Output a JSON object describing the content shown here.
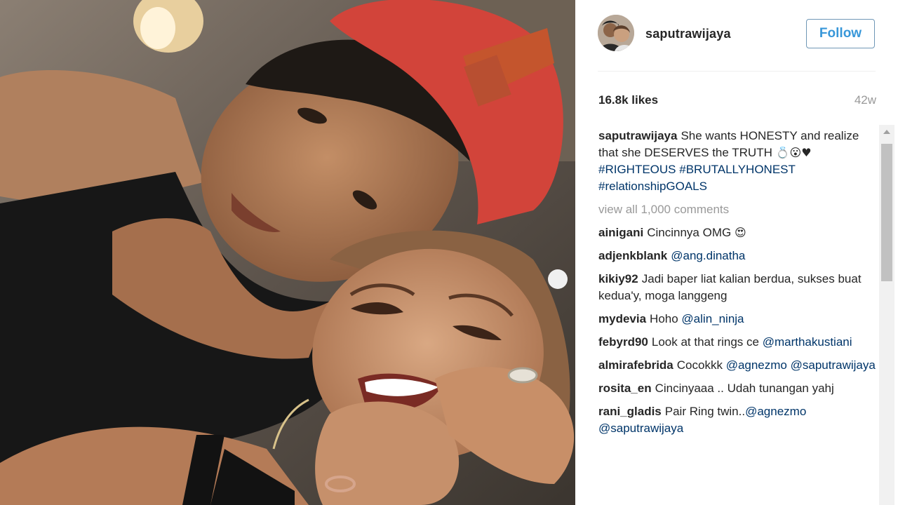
{
  "post": {
    "photo_alt": "",
    "username": "saputrawijaya",
    "follow_label": "Follow",
    "likes": "16.8k likes",
    "age": "42w"
  },
  "caption": {
    "user": "saputrawijaya",
    "text_1": "She wants HONESTY and realize that she DESERVES the TRUTH",
    "emojis": "💍😮♥",
    "tag_1": "#RIGHTEOUS",
    "tag_2": "#BRUTALLYHONEST",
    "tag_3": "#relationshipGOALS"
  },
  "view_all": "view all 1,000 comments",
  "comments": [
    {
      "user": "ainigani",
      "text": "Cincinnya OMG",
      "emoji": "😍",
      "mention": ""
    },
    {
      "user": "adjenkblank",
      "text": "",
      "emoji": "",
      "mention": "@ang.dinatha"
    },
    {
      "user": "kikiy92",
      "text": "Jadi baper liat kalian berdua, sukses buat kedua'y, moga langgeng",
      "emoji": "",
      "mention": ""
    },
    {
      "user": "mydevia",
      "text": "Hoho",
      "emoji": "",
      "mention": "@alin_ninja"
    },
    {
      "user": "febyrd90",
      "text": "Look at that rings ce",
      "emoji": "",
      "mention": "@marthakustiani"
    },
    {
      "user": "almirafebrida",
      "text": "Cocokkk",
      "emoji": "",
      "mention": "@agnezmo",
      "mention_2": "@saputrawijaya"
    },
    {
      "user": "rosita_en",
      "text": "Cincinyaaa .. Udah tunangan yahj",
      "emoji": "",
      "mention": ""
    },
    {
      "user": "rani_gladis",
      "text": "Pair Ring twin..",
      "emoji": "",
      "mention": "@agnezmo",
      "mention_2": "@saputrawijaya"
    }
  ],
  "icons": {
    "scroll_up": "triangle-up-icon"
  },
  "colors": {
    "follow_border": "#6f97b6",
    "follow_text": "#3897d9",
    "hashtag": "#003569",
    "muted": "#999999"
  }
}
